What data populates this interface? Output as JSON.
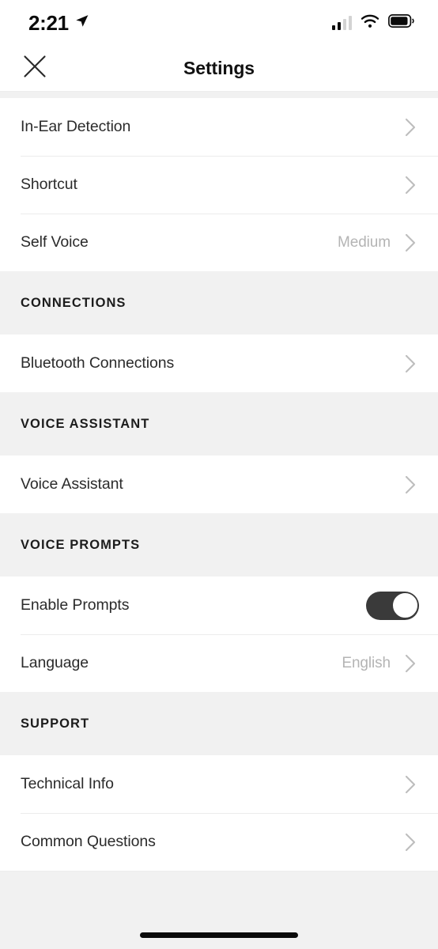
{
  "status_bar": {
    "time": "2:21",
    "location_icon": "location-arrow-icon",
    "signal_icon": "cellular-signal-icon",
    "signal_bars_filled": 2,
    "signal_bars_total": 4,
    "wifi_icon": "wifi-icon",
    "battery_icon": "battery-icon",
    "battery_level_percent": 88
  },
  "nav": {
    "close_icon": "close-x-icon",
    "title": "Settings"
  },
  "sections": [
    {
      "header": null,
      "rows": [
        {
          "label": "In-Ear Detection",
          "value": null,
          "control": "chevron"
        },
        {
          "label": "Shortcut",
          "value": null,
          "control": "chevron"
        },
        {
          "label": "Self Voice",
          "value": "Medium",
          "control": "chevron"
        }
      ]
    },
    {
      "header": "CONNECTIONS",
      "rows": [
        {
          "label": "Bluetooth Connections",
          "value": null,
          "control": "chevron"
        }
      ]
    },
    {
      "header": "VOICE ASSISTANT",
      "rows": [
        {
          "label": "Voice Assistant",
          "value": null,
          "control": "chevron"
        }
      ]
    },
    {
      "header": "VOICE PROMPTS",
      "rows": [
        {
          "label": "Enable Prompts",
          "value": null,
          "control": "toggle",
          "toggle_on": true
        },
        {
          "label": "Language",
          "value": "English",
          "control": "chevron"
        }
      ]
    },
    {
      "header": "SUPPORT",
      "rows": [
        {
          "label": "Technical Info",
          "value": null,
          "control": "chevron"
        },
        {
          "label": "Common Questions",
          "value": null,
          "control": "chevron"
        }
      ]
    }
  ],
  "home_indicator": "home-indicator-bar",
  "colors": {
    "background": "#ffffff",
    "section_background": "#f1f1f1",
    "primary_text": "#2b2b2b",
    "secondary_text": "#b4b4b4",
    "divider": "#ececec",
    "toggle_on": "#3a3a3a"
  }
}
